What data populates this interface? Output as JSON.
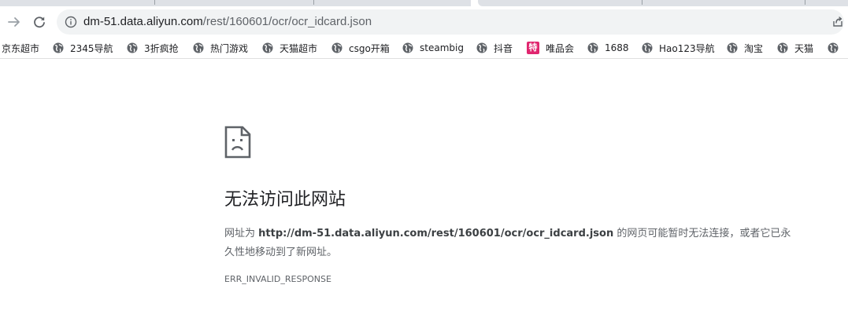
{
  "browser": {
    "address_bar": {
      "host": "dm-51.data.aliyun.com",
      "path": "/rest/160601/ocr/ocr_idcard.json"
    }
  },
  "bookmarks": [
    {
      "label": "京东超市",
      "icon": "globe-icon"
    },
    {
      "label": "2345导航",
      "icon": "globe-icon"
    },
    {
      "label": "3折疯抢",
      "icon": "globe-icon"
    },
    {
      "label": "热门游戏",
      "icon": "globe-icon"
    },
    {
      "label": "天猫超市",
      "icon": "globe-icon"
    },
    {
      "label": "csgo开箱",
      "icon": "globe-icon"
    },
    {
      "label": "steambig",
      "icon": "globe-icon"
    },
    {
      "label": "抖音",
      "icon": "globe-icon"
    },
    {
      "label": "唯品会",
      "icon": "vip-icon",
      "icon_text": "特"
    },
    {
      "label": "1688",
      "icon": "globe-icon"
    },
    {
      "label": "Hao123导航",
      "icon": "globe-icon"
    },
    {
      "label": "淘宝",
      "icon": "globe-icon"
    },
    {
      "label": "天猫",
      "icon": "globe-icon"
    },
    {
      "label": "",
      "icon": "globe-icon"
    }
  ],
  "error": {
    "title": "无法访问此网站",
    "desc_prefix": "网址为 ",
    "desc_url": "http://dm-51.data.aliyun.com/rest/160601/ocr/ocr_idcard.json",
    "desc_suffix": " 的网页可能暂时无法连接，或者它已永久性地移动到了新网址。",
    "code": "ERR_INVALID_RESPONSE"
  },
  "colors": {
    "vip_badge": "#e0266f",
    "omnibox_bg": "#f1f3f4"
  }
}
